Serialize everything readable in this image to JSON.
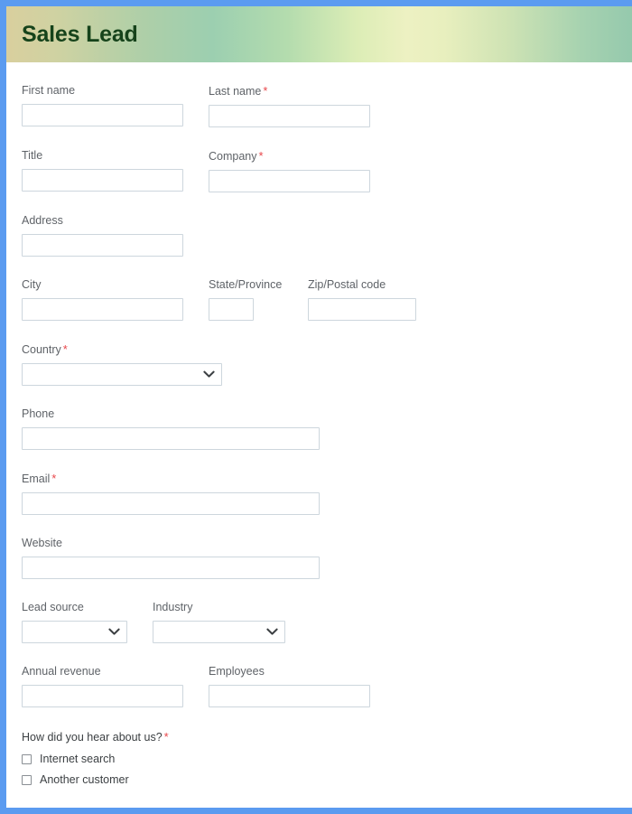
{
  "page": {
    "frame_color": "#5b9bf0",
    "background": "#ffffff"
  },
  "header": {
    "title": "Sales Lead",
    "title_color": "#16431b",
    "gradient_from": "#d9cf9e",
    "gradient_mid": "#edf1c2",
    "gradient_to": "#95c9ad"
  },
  "form": {
    "required_marker": "*",
    "required_color": "#e8464a",
    "fields": {
      "first_name": {
        "label": "First name",
        "required": false,
        "value": "",
        "placeholder": ""
      },
      "last_name": {
        "label": "Last name",
        "required": true,
        "value": "",
        "placeholder": ""
      },
      "title": {
        "label": "Title",
        "required": false,
        "value": "",
        "placeholder": ""
      },
      "company": {
        "label": "Company",
        "required": true,
        "value": "",
        "placeholder": ""
      },
      "address": {
        "label": "Address",
        "required": false,
        "value": "",
        "placeholder": ""
      },
      "city": {
        "label": "City",
        "required": false,
        "value": "",
        "placeholder": ""
      },
      "state": {
        "label": "State/Province",
        "required": false,
        "value": "",
        "placeholder": ""
      },
      "zip": {
        "label": "Zip/Postal code",
        "required": false,
        "value": "",
        "placeholder": ""
      },
      "country": {
        "label": "Country",
        "required": true,
        "value": "",
        "selected": ""
      },
      "phone": {
        "label": "Phone",
        "required": false,
        "value": "",
        "placeholder": ""
      },
      "email": {
        "label": "Email",
        "required": true,
        "value": "",
        "placeholder": ""
      },
      "website": {
        "label": "Website",
        "required": false,
        "value": "",
        "placeholder": ""
      },
      "lead_source": {
        "label": "Lead source",
        "required": false,
        "value": "",
        "selected": ""
      },
      "industry": {
        "label": "Industry",
        "required": false,
        "value": "",
        "selected": ""
      },
      "annual_revenue": {
        "label": "Annual revenue",
        "required": false,
        "value": "",
        "placeholder": ""
      },
      "employees": {
        "label": "Employees",
        "required": false,
        "value": "",
        "placeholder": ""
      }
    },
    "hear_about_us": {
      "label": "How did you hear about us?",
      "required": true,
      "options": [
        {
          "label": "Internet search",
          "checked": false
        },
        {
          "label": "Another customer",
          "checked": false
        }
      ]
    }
  },
  "icons": {
    "chevron_down": "chevron-down-icon"
  }
}
